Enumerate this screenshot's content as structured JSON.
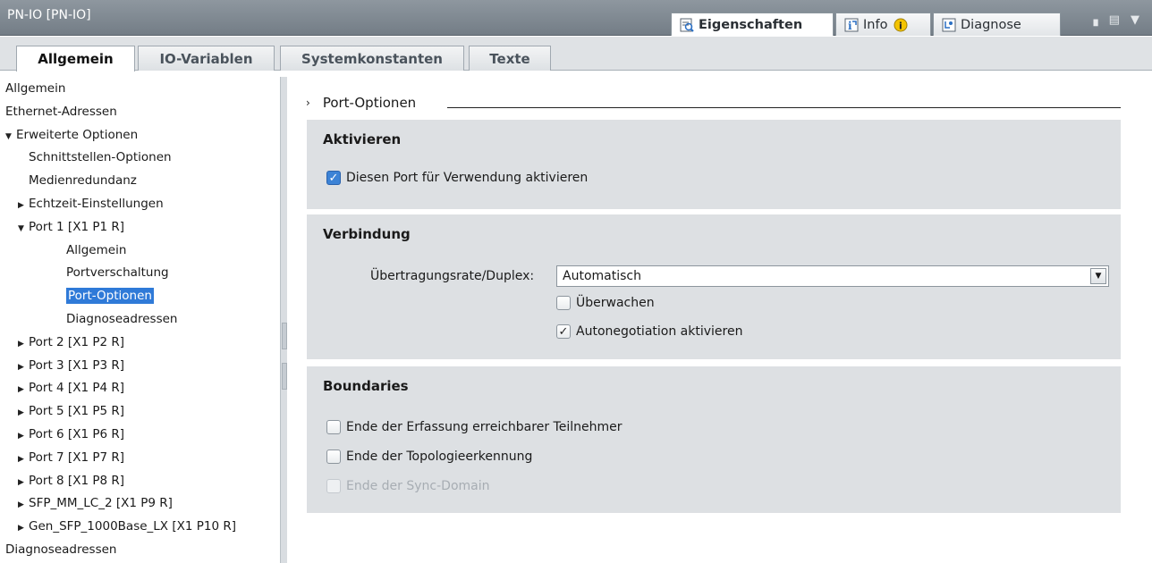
{
  "window": {
    "title": "PN-IO [PN-IO]",
    "panel_tabs": [
      {
        "label": "Eigenschaften",
        "icon": "properties-icon",
        "active": true
      },
      {
        "label": "Info",
        "icon": "info-icon",
        "badge_icon": "info-badge-icon",
        "active": false
      },
      {
        "label": "Diagnose",
        "icon": "diagnostics-icon",
        "active": false
      }
    ],
    "controls": "▗ ▤ ▼"
  },
  "tabs": [
    {
      "label": "Allgemein",
      "active": true
    },
    {
      "label": "IO-Variablen",
      "active": false
    },
    {
      "label": "Systemkonstanten",
      "active": false
    },
    {
      "label": "Texte",
      "active": false
    }
  ],
  "tree": [
    {
      "label": "Allgemein",
      "level": 0,
      "arrow": ""
    },
    {
      "label": "Ethernet-Adressen",
      "level": 0,
      "arrow": ""
    },
    {
      "label": "Erweiterte Optionen",
      "level": 0,
      "arrow": "▼"
    },
    {
      "label": "Schnittstellen-Optionen",
      "level": 1,
      "arrow": ""
    },
    {
      "label": "Medienredundanz",
      "level": 1,
      "arrow": ""
    },
    {
      "label": "Echtzeit-Einstellungen",
      "level": 1,
      "arrow": "▶"
    },
    {
      "label": "Port 1 [X1 P1 R]",
      "level": 1,
      "arrow": "▼"
    },
    {
      "label": "Allgemein",
      "level": 2,
      "arrow": ""
    },
    {
      "label": "Portverschaltung",
      "level": 2,
      "arrow": ""
    },
    {
      "label": "Port-Optionen",
      "level": 2,
      "arrow": "",
      "selected": true
    },
    {
      "label": "Diagnoseadressen",
      "level": 2,
      "arrow": ""
    },
    {
      "label": "Port 2 [X1 P2 R]",
      "level": 1,
      "arrow": "▶"
    },
    {
      "label": "Port 3 [X1 P3 R]",
      "level": 1,
      "arrow": "▶"
    },
    {
      "label": "Port 4 [X1 P4 R]",
      "level": 1,
      "arrow": "▶"
    },
    {
      "label": "Port 5 [X1 P5 R]",
      "level": 1,
      "arrow": "▶"
    },
    {
      "label": "Port 6 [X1 P6 R]",
      "level": 1,
      "arrow": "▶"
    },
    {
      "label": "Port 7 [X1 P7 R]",
      "level": 1,
      "arrow": "▶"
    },
    {
      "label": "Port 8 [X1 P8 R]",
      "level": 1,
      "arrow": "▶"
    },
    {
      "label": "SFP_MM_LC_2 [X1 P9 R]",
      "level": 1,
      "arrow": "▶"
    },
    {
      "label": "Gen_SFP_1000Base_LX [X1 P10 R]",
      "level": 1,
      "arrow": "▶"
    },
    {
      "label": "Diagnoseadressen",
      "level": 0,
      "arrow": ""
    }
  ],
  "main": {
    "section_title": "Port-Optionen",
    "aktivieren": {
      "title": "Aktivieren",
      "port_enable_label": "Diesen Port für Verwendung aktivieren",
      "port_enable_checked": true
    },
    "verbindung": {
      "title": "Verbindung",
      "rate_label": "Übertragungsrate/Duplex:",
      "rate_value": "Automatisch",
      "monitor_label": "Überwachen",
      "monitor_checked": false,
      "autoneg_label": "Autonegotiation aktivieren",
      "autoneg_checked": true
    },
    "boundaries": {
      "title": "Boundaries",
      "end_detection_label": "Ende der Erfassung erreichbarer Teilnehmer",
      "end_topology_label": "Ende der Topologieerkennung",
      "end_sync_label": "Ende der Sync-Domain",
      "end_sync_disabled": true
    }
  }
}
